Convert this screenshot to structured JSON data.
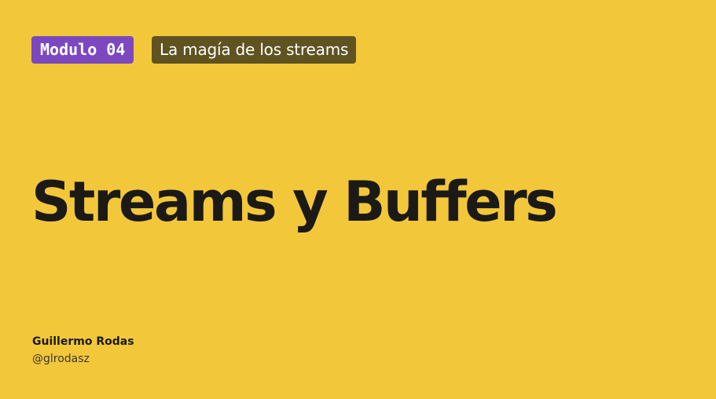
{
  "slide": {
    "module_badge": "Modulo 04",
    "topic_badge": "La magía de los streams",
    "title": "Streams y Buffers",
    "author": {
      "name": "Guillermo Rodas",
      "handle": "@glrodasz"
    }
  },
  "colors": {
    "background": "#F3C73A",
    "module_badge_bg": "#7C48C0",
    "topic_badge_bg": "#5F5322",
    "title_text": "#1B1A16"
  }
}
